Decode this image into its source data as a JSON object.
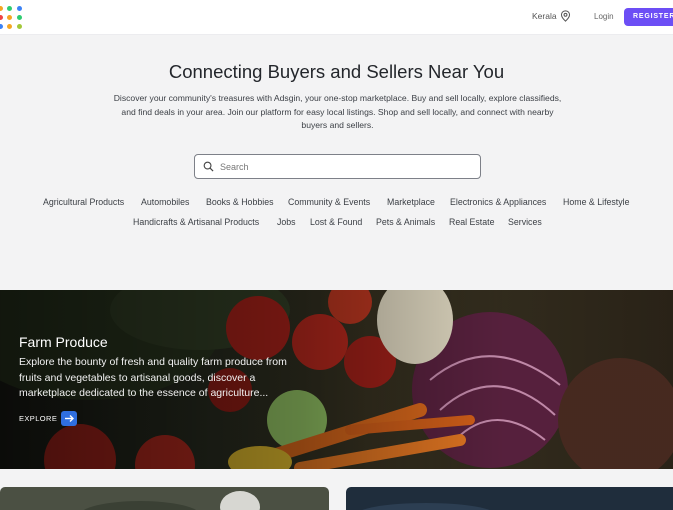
{
  "header": {
    "location_label": "Kerala",
    "login_label": "Login",
    "register_label": "REGISTER"
  },
  "hero": {
    "title": "Connecting Buyers and Sellers Near You",
    "description": "Discover your community's treasures with Adsgin, your one-stop marketplace. Buy and sell locally, explore classifieds, and find deals in your area. Join our platform for easy local listings. Shop and sell locally, and connect with nearby buyers and sellers."
  },
  "search": {
    "placeholder": "Search"
  },
  "categories": [
    "Agricultural Products",
    "Automobiles",
    "Books & Hobbies",
    "Community & Events",
    "Marketplace",
    "Electronics & Appliances",
    "Home & Lifestyle",
    "Handicrafts & Artisanal Products",
    "Jobs",
    "Lost & Found",
    "Pets & Animals",
    "Real Estate",
    "Services"
  ],
  "banner": {
    "title": "Farm Produce",
    "description": "Explore the bounty of fresh and quality farm produce from fruits and vegetables to artisanal goods, discover a marketplace dedicated to the essence of agriculture...",
    "explore_label": "EXPLORE"
  },
  "colors": {
    "accent": "#6c4ef5",
    "explore_button": "#2f6fe0"
  },
  "icons": {
    "logo": "dots-logo",
    "location": "location-pin-icon",
    "search": "search-icon",
    "explore": "arrow-right-icon"
  }
}
